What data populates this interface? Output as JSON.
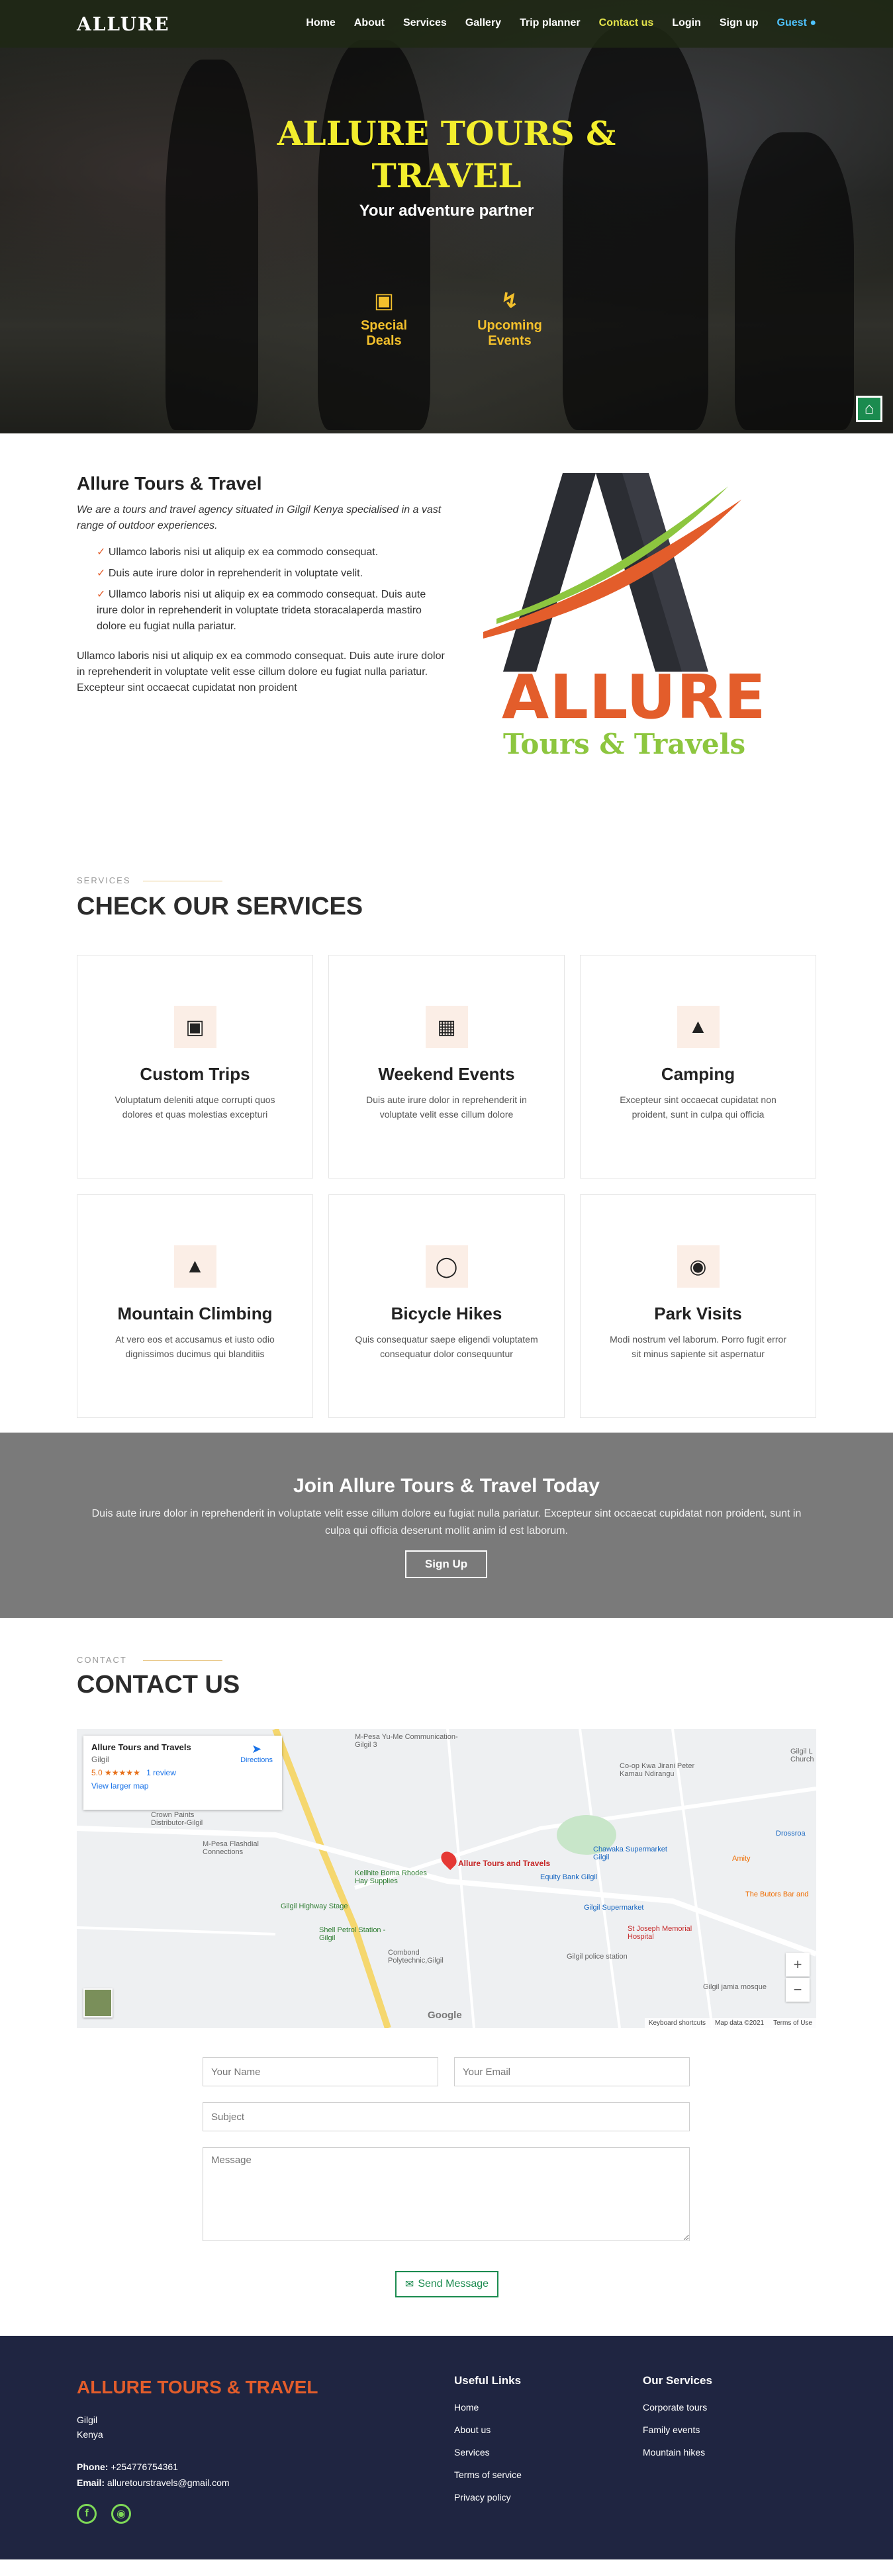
{
  "header": {
    "logo": "ALLURE",
    "nav": [
      "Home",
      "About",
      "Services",
      "Gallery",
      "Trip planner",
      "Contact us",
      "Login",
      "Sign up",
      "Guest"
    ],
    "active_item": "Contact us"
  },
  "hero": {
    "title_line1": "ALLURE TOURS &",
    "title_line2": "TRAVEL",
    "subtitle": "Your adventure partner",
    "features": [
      {
        "label_line1": "Special",
        "label_line2": "Deals",
        "icon": "bus-icon"
      },
      {
        "label_line1": "Upcoming",
        "label_line2": "Events",
        "icon": "route-icon"
      }
    ]
  },
  "about": {
    "title": "Allure Tours & Travel",
    "intro": "We are a tours and travel agency situated in Gilgil Kenya specialised in a vast range of outdoor experiences.",
    "bullets": [
      "Ullamco laboris nisi ut aliquip ex ea commodo consequat.",
      "Duis aute irure dolor in reprehenderit in voluptate velit.",
      "Ullamco laboris nisi ut aliquip ex ea commodo consequat. Duis aute irure dolor in reprehenderit in voluptate trideta storacalaperda mastiro dolore eu fugiat nulla pariatur."
    ],
    "outro": "Ullamco laboris nisi ut aliquip ex ea commodo consequat. Duis aute irure dolor in reprehenderit in voluptate velit esse cillum dolore eu fugiat nulla pariatur. Excepteur sint occaecat cupidatat non proident",
    "logo_word": "ALLURE",
    "logo_tagline": "Tours & Travels"
  },
  "services": {
    "label": "SERVICES",
    "title": "CHECK OUR SERVICES",
    "cards": [
      {
        "title": "Custom Trips",
        "text": "Voluptatum deleniti atque corrupti quos dolores et quas molestias excepturi",
        "icon": "bus-icon"
      },
      {
        "title": "Weekend Events",
        "text": "Duis aute irure dolor in reprehenderit in voluptate velit esse cillum dolore",
        "icon": "calendar-icon"
      },
      {
        "title": "Camping",
        "text": "Excepteur sint occaecat cupidatat non proident, sunt in culpa qui officia",
        "icon": "tent-icon"
      },
      {
        "title": "Mountain Climbing",
        "text": "At vero eos et accusamus et iusto odio dignissimos ducimus qui blanditiis",
        "icon": "mountain-icon"
      },
      {
        "title": "Bicycle Hikes",
        "text": "Quis consequatur saepe eligendi voluptatem consequatur dolor consequuntur",
        "icon": "bicycle-icon"
      },
      {
        "title": "Park Visits",
        "text": "Modi nostrum vel laborum. Porro fugit error sit minus sapiente sit aspernatur",
        "icon": "map-pin-icon"
      }
    ]
  },
  "cta": {
    "title": "Join Allure Tours & Travel Today",
    "text": "Duis aute irure dolor in reprehenderit in voluptate velit esse cillum dolore eu fugiat nulla pariatur. Excepteur sint occaecat cupidatat non proident, sunt in culpa qui officia deserunt mollit anim id est laborum.",
    "button": "Sign Up"
  },
  "contact": {
    "label": "CONTACT",
    "title": "CONTACT US",
    "map": {
      "place_name": "Allure Tours and Travels",
      "place_area": "Gilgil",
      "rating": "5.0",
      "stars": "★★★★★",
      "reviews": "1 review",
      "directions": "Directions",
      "larger_map": "View larger map",
      "pin_label": "Allure Tours and Travels",
      "labels": [
        "M-Pesa Yu-Me Communication-Gilgil 3",
        "Co-op Kwa Jirani Peter Kamau Ndirangu",
        "Crown Paints Distributor-Gilgil",
        "M-Pesa Flashdial Connections",
        "Kellhite Boma Rhodes Hay Supplies",
        "Chawaka Supermarket Gilgil",
        "Equity Bank Gilgil",
        "Gilgil Highway Stage",
        "Shell Petrol Station -Gilgil",
        "Gilgil Supermarket",
        "St Joseph Memorial Hospital",
        "Combond Polytechnic,Gilgil",
        "Gilgil police station",
        "Gilgil jamia mosque",
        "The Butors Bar and",
        "Amity",
        "Drossroa",
        "Gilgil L Church"
      ],
      "footer_items": [
        "Keyboard shortcuts",
        "Map data ©2021",
        "Terms of Use"
      ],
      "google": "Google",
      "zoom_in": "+",
      "zoom_out": "−"
    },
    "form": {
      "name_placeholder": "Your Name",
      "email_placeholder": "Your Email",
      "subject_placeholder": "Subject",
      "message_placeholder": "Message",
      "send": "Send Message"
    }
  },
  "footer": {
    "brand": "ALLURE TOURS & TRAVEL",
    "address_line1": "Gilgil",
    "address_line2": "Kenya",
    "phone_label": "Phone:",
    "phone": "+254776754361",
    "email_label": "Email:",
    "email": "alluretourstravels@gmail.com",
    "useful_links_title": "Useful Links",
    "useful_links": [
      "Home",
      "About us",
      "Services",
      "Terms of service",
      "Privacy policy"
    ],
    "services_title": "Our Services",
    "services_links": [
      "Corporate tours",
      "Family events",
      "Mountain hikes"
    ]
  }
}
